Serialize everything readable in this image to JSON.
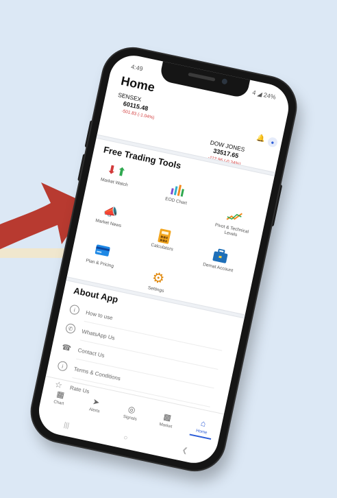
{
  "status_bar": {
    "time": "4:49",
    "signal": "4 ◢ 24%"
  },
  "home": {
    "title": "Home"
  },
  "tickers": [
    {
      "name": "SENSEX",
      "value": "60115.48",
      "change": "-501.83 (-1.04%)"
    },
    {
      "name": "DOW JONES",
      "value": "33517.65",
      "change": "-112.96 (-0.34%)"
    }
  ],
  "tools_section": {
    "title": "Free Trading Tools",
    "items": [
      {
        "label": "Market Watch",
        "icon": "up-down-arrows-icon"
      },
      {
        "label": "EOD Chart",
        "icon": "bar-chart-icon"
      },
      {
        "label": "Pivot & Technical Levels",
        "icon": "trend-chart-icon"
      },
      {
        "label": "Market News",
        "icon": "megaphone-icon"
      },
      {
        "label": "Calculators",
        "icon": "calculator-icon"
      },
      {
        "label": "Demat Account",
        "icon": "briefcase-icon"
      },
      {
        "label": "Plan & Pricing",
        "icon": "credit-card-icon"
      },
      {
        "label": "Settings",
        "icon": "gear-icon"
      }
    ]
  },
  "about_section": {
    "title": "About App",
    "items": [
      {
        "label": "How to use",
        "icon": "info-icon"
      },
      {
        "label": "WhatsApp Us",
        "icon": "whatsapp-icon"
      },
      {
        "label": "Contact Us",
        "icon": "phone-icon"
      },
      {
        "label": "Terms & Conditions",
        "icon": "info-icon"
      },
      {
        "label": "Rate Us",
        "icon": "star-icon"
      }
    ]
  },
  "bottom_nav": [
    {
      "label": "Chart",
      "icon": "chart-icon",
      "active": false
    },
    {
      "label": "Alerts",
      "icon": "send-icon",
      "active": false
    },
    {
      "label": "Signals",
      "icon": "signal-icon",
      "active": false
    },
    {
      "label": "Market",
      "icon": "market-icon",
      "active": false
    },
    {
      "label": "Home",
      "icon": "home-icon",
      "active": true
    }
  ],
  "colors": {
    "background": "#dce8f5",
    "arrow": "#b83a30",
    "accent": "#2a5bd7",
    "negative": "#d23a3a"
  }
}
